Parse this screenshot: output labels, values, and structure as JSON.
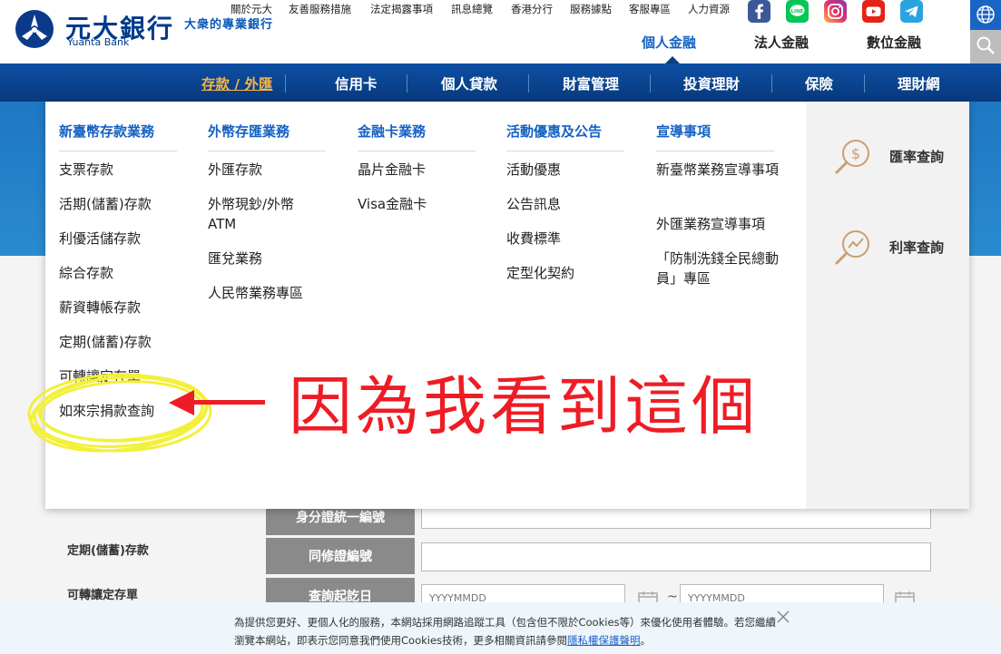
{
  "brand": {
    "name_cn": "元大銀行",
    "name_en": "Yuanta Bank",
    "tagline": "大衆的專業銀行"
  },
  "top_links": [
    "關於元大",
    "友善服務措施",
    "法定揭露事項",
    "訊息總覽",
    "香港分行",
    "服務據點",
    "客服專區",
    "人力資源"
  ],
  "social_icons": [
    "facebook-icon",
    "line-icon",
    "instagram-icon",
    "youtube-icon",
    "telegram-icon"
  ],
  "business_tabs": [
    "個人金融",
    "法人金融",
    "數位金融"
  ],
  "main_nav": [
    "存款 / 外匯",
    "信用卡",
    "個人貸款",
    "財富管理",
    "投資理財",
    "保險",
    "理財網"
  ],
  "mega_menu": {
    "columns": [
      {
        "title": "新臺幣存款業務",
        "items": [
          "支票存款",
          "活期(儲蓄)存款",
          "利優活儲存款",
          "綜合存款",
          "薪資轉帳存款",
          "定期(儲蓄)存款",
          "可轉讓定存單",
          "如來宗捐款查詢"
        ]
      },
      {
        "title": "外幣存匯業務",
        "items": [
          "外匯存款",
          "外幣現鈔/外幣ATM",
          "匯兌業務",
          "人民幣業務專區"
        ]
      },
      {
        "title": "金融卡業務",
        "items": [
          "晶片金融卡",
          "Visa金融卡"
        ]
      },
      {
        "title": "活動優惠及公告",
        "items": [
          "活動優惠",
          "公告訊息",
          "收費標準",
          "定型化契約"
        ]
      },
      {
        "title": "宣導事項",
        "items": [
          "新臺幣業務宣導事項",
          "外匯業務宣導事項",
          "「防制洗錢全民總動員」專區"
        ]
      }
    ],
    "quick_links": [
      {
        "label": "匯率查詢",
        "icon": "exchange-rate-icon"
      },
      {
        "label": "利率查詢",
        "icon": "interest-rate-icon"
      }
    ]
  },
  "annotation": {
    "text": "因為我看到這個",
    "color": "#ee1c25"
  },
  "background_sidebar": [
    "定期(儲蓄)存款",
    "可轉讓定存單"
  ],
  "form": {
    "labels": [
      "身分證統一編號",
      "同修證編號",
      "查詢起訖日"
    ],
    "date_placeholder_start": "YYYYMMDD",
    "date_placeholder_end": "YYYYMMDD",
    "range_sep": "~"
  },
  "cookie": {
    "text_before": "為提供您更好、更個人化的服務，本網站採用網路追蹤工具（包含但不限於Cookies等）來優化使用者體驗。若您繼續瀏覽本網站，即表示您同意我們使用Cookies技術，更多相關資訊請參閱",
    "link": "隱私權保護聲明",
    "text_after": "。"
  },
  "colors": {
    "brand_blue": "#003a8c",
    "nav_blue": "#0a3f85",
    "link_blue": "#1461c4",
    "active_nav": "#f5b54a"
  }
}
